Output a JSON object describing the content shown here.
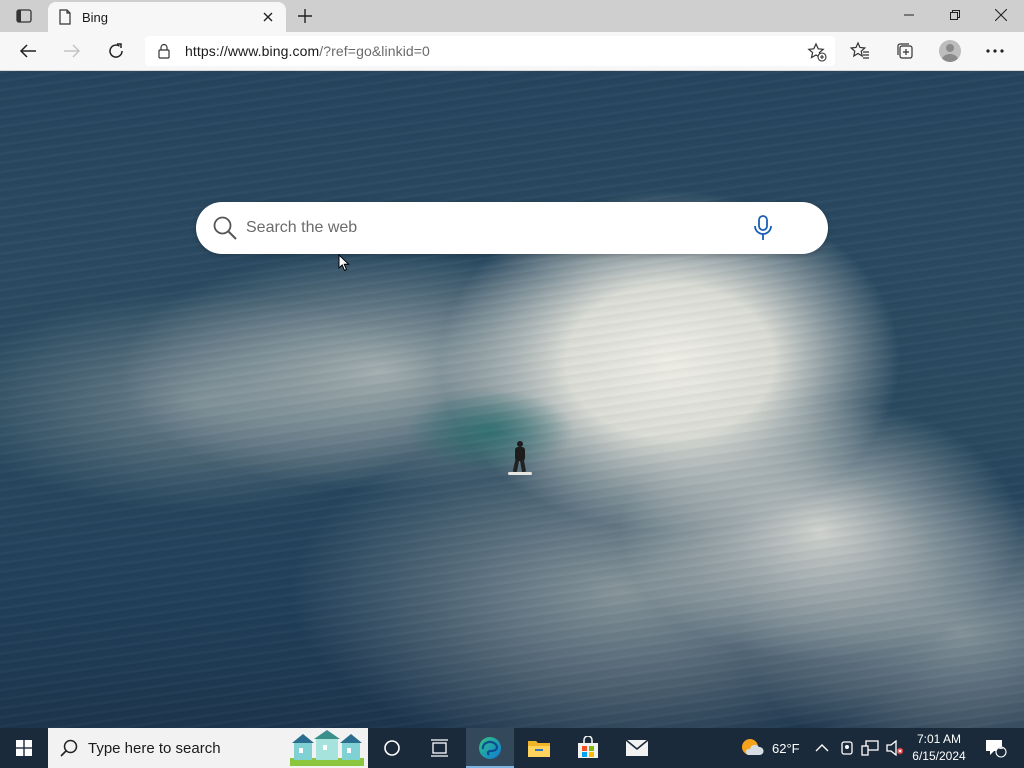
{
  "browser": {
    "tab": {
      "title": "Bing",
      "favicon": "page-icon"
    },
    "window_controls": {
      "minimize": "minimize-icon",
      "restore": "restore-icon",
      "close": "close-icon"
    },
    "address": {
      "host_part": "https://www.bing.com",
      "rest_part": "/?ref=go&linkid=0"
    },
    "toolbar_icons": [
      "back-icon",
      "forward-icon",
      "refresh-icon",
      "lock-icon",
      "add-favorite-icon",
      "favorites-icon",
      "collections-icon",
      "profile-icon",
      "more-icon"
    ]
  },
  "page": {
    "search": {
      "placeholder": "Search the web"
    },
    "background": "surfer riding a large breaking wave"
  },
  "taskbar": {
    "search_placeholder": "Type here to search",
    "pinned": [
      "cortana-icon",
      "task-view-icon",
      "edge-icon",
      "file-explorer-icon",
      "store-icon",
      "mail-icon"
    ],
    "weather": {
      "temp": "62°F",
      "icon": "partly-sunny-icon"
    },
    "clock": {
      "time": "7:01 AM",
      "date": "6/15/2024"
    },
    "notifications_count": "1"
  }
}
